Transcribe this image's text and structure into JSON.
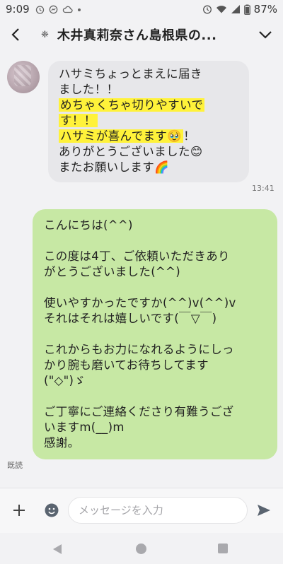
{
  "status_bar": {
    "time": "9:09",
    "left_icons": [
      "alarm-icon",
      "messenger-icon",
      "cloud-icon",
      "dot-icon"
    ],
    "right_icons": [
      "alarm-icon",
      "wifi-icon",
      "signal-icon",
      "battery-icon"
    ],
    "battery": "87%"
  },
  "header": {
    "mark": "❈",
    "title": "木井真莉奈さん島根県の..."
  },
  "incoming": {
    "lines": [
      {
        "text": "ハサミちょっとまえに届き",
        "highlight": false
      },
      {
        "text": "ました！！",
        "highlight": false
      },
      {
        "text": "めちゃくちゃ切りやすいで",
        "highlight": true
      },
      {
        "text": "す！！",
        "highlight": true
      },
      {
        "text": "ハサミが喜んでます🥹",
        "highlight": true,
        "suffix": "！"
      },
      {
        "text": "ありがとうございました😊",
        "highlight": false
      },
      {
        "text": "またお願いします🌈",
        "highlight": false
      }
    ],
    "time": "13:41"
  },
  "outgoing": {
    "lines": [
      "こんにちは(^^)",
      "",
      "この度は4丁、ご依頼いただきあり",
      "がとうございました(^^)",
      "",
      "使いやすかったですか(^^)v(^^)v",
      "それはそれは嬉しいです(￣▽￣)",
      "",
      "これからもお力になれるようにしっ",
      "かり腕も磨いてお待ちしてます",
      "(\"◇\")ゞ",
      "",
      "ご丁寧にご連絡くださり有難うござ",
      "いますm(__)m",
      "感謝。"
    ],
    "read_label": "既読"
  },
  "input_bar": {
    "placeholder": "メッセージを入力"
  },
  "colors": {
    "incoming_bubble": "#e7e7ea",
    "outgoing_bubble": "#c7e8a4",
    "highlight": "#fff23a",
    "background": "#f2f2f4"
  }
}
